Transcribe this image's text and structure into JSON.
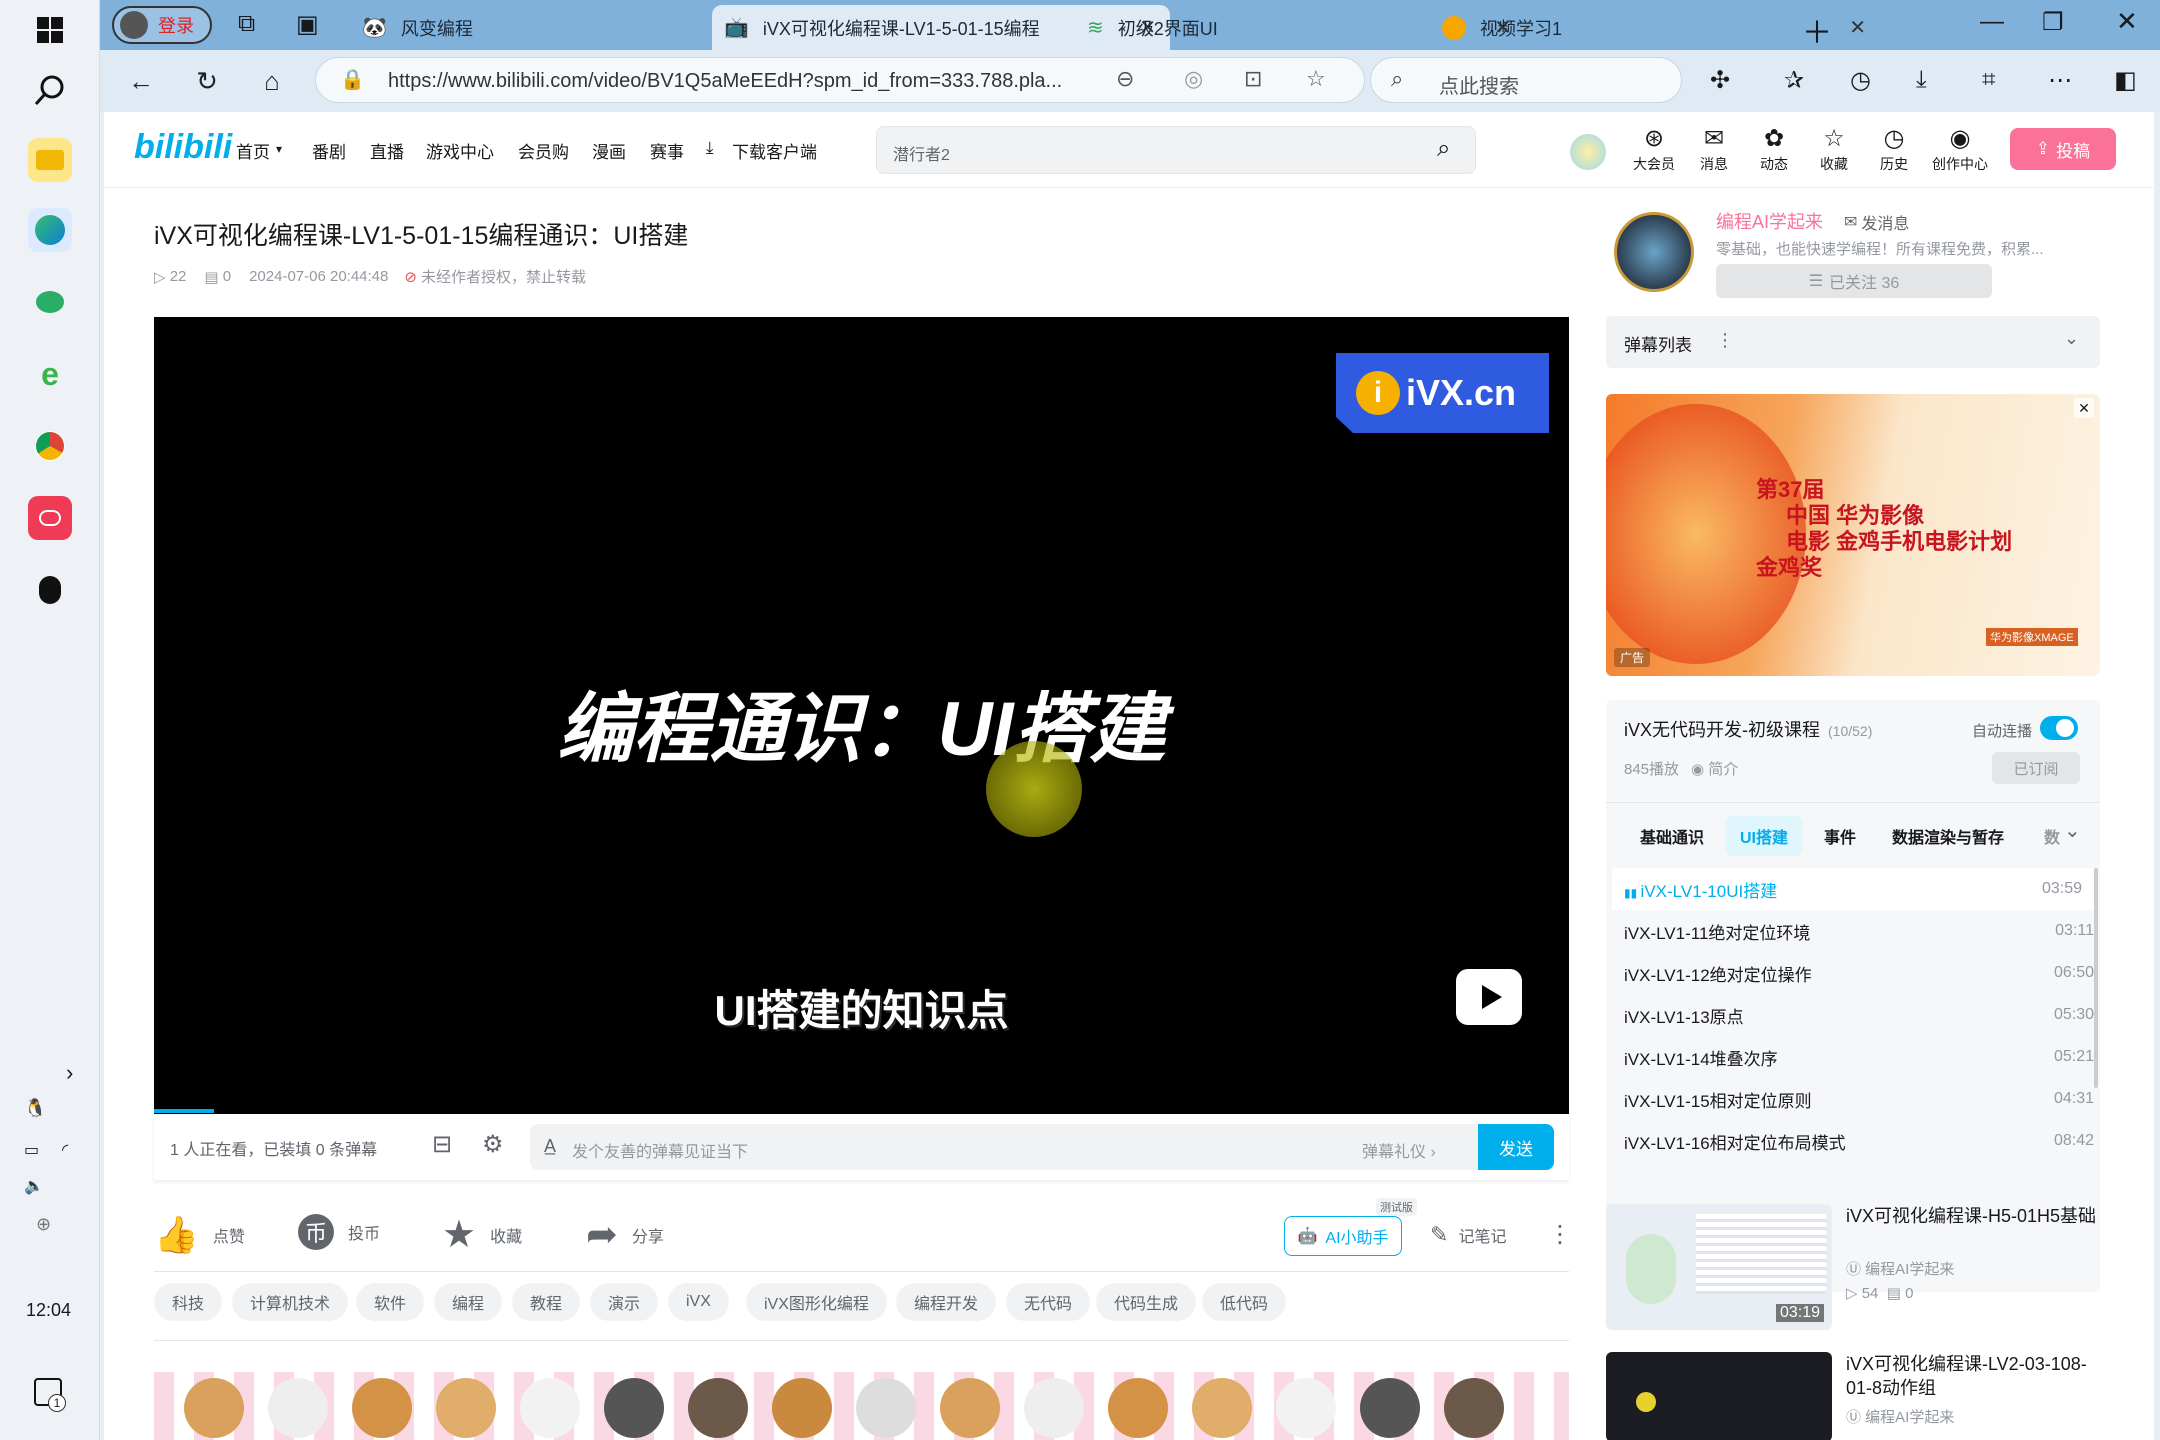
{
  "taskbar": {
    "clock": "12:04",
    "notif_count": "1"
  },
  "browser": {
    "login_label": "登录",
    "tabs": [
      {
        "title": "风变编程"
      },
      {
        "title": "iVX可视化编程课-LV1-5-01-15编程"
      },
      {
        "title": "初级2界面UI"
      },
      {
        "title": "视频学习1"
      }
    ],
    "url": "https://www.bilibili.com/video/BV1Q5aMeEEdH?spm_id_from=333.788.pla...",
    "search_placeholder": "点此搜索"
  },
  "site": {
    "logo": "bilibili",
    "nav": [
      "首页",
      "番剧",
      "直播",
      "游戏中心",
      "会员购",
      "漫画",
      "赛事",
      "下载客户端"
    ],
    "search_value": "潜行者2",
    "right_icons": [
      "大会员",
      "消息",
      "动态",
      "收藏",
      "历史",
      "创作中心"
    ],
    "upload_label": "投稿"
  },
  "video": {
    "title": "iVX可视化编程课-LV1-5-01-15编程通识：UI搭建",
    "views": "22",
    "danmaku": "0",
    "date": "2024-07-06 20:44:48",
    "copyright": "未经作者授权，禁止转载",
    "frame_watermark": "iVX.cn",
    "frame_title": "编程通识：UI搭建",
    "frame_subtitle": "UI搭建的知识点",
    "watching": "1 人正在看，已装填 0 条弹幕",
    "danmaku_placeholder": "发个友善的弹幕见证当下",
    "danmaku_etiquette": "弹幕礼仪 ›",
    "send_label": "发送"
  },
  "actions": {
    "like": "点赞",
    "coin": "投币",
    "fav": "收藏",
    "share": "分享",
    "ai": "AI小助手",
    "ai_badge": "测试版",
    "note": "记笔记"
  },
  "tags": [
    "科技",
    "计算机技术",
    "软件",
    "编程",
    "教程",
    "演示",
    "iVX",
    "iVX图形化编程",
    "编程开发",
    "无代码",
    "代码生成",
    "低代码"
  ],
  "uploader": {
    "name": "编程AI学起来",
    "message": "发消息",
    "desc": "零基础，也能快速学编程！所有课程免费，积累...",
    "follow": "已关注 36"
  },
  "danmaku_list": {
    "title": "弹幕列表"
  },
  "ad": {
    "line1": "第37届",
    "line2": "中国 华为影像",
    "line3": "电影 金鸡手机电影计划",
    "line4": "金鸡奖",
    "brand": "华为影像XMAGE",
    "badge": "广告"
  },
  "collection": {
    "title": "iVX无代码开发-初级课程",
    "count": "(10/52)",
    "autoplay": "自动连播",
    "plays": "845播放",
    "intro": "简介",
    "subscribed": "已订阅",
    "tabs": [
      "基础通识",
      "UI搭建",
      "事件",
      "数据渲染与暂存",
      "数"
    ],
    "episodes": [
      {
        "title": "iVX-LV1-10UI搭建",
        "dur": "03:59"
      },
      {
        "title": "iVX-LV1-11绝对定位环境",
        "dur": "03:11"
      },
      {
        "title": "iVX-LV1-12绝对定位操作",
        "dur": "06:50"
      },
      {
        "title": "iVX-LV1-13原点",
        "dur": "05:30"
      },
      {
        "title": "iVX-LV1-14堆叠次序",
        "dur": "05:21"
      },
      {
        "title": "iVX-LV1-15相对定位原则",
        "dur": "04:31"
      },
      {
        "title": "iVX-LV1-16相对定位布局模式",
        "dur": "08:42"
      }
    ]
  },
  "recommend": [
    {
      "title": "iVX可视化编程课-H5-01H5基础",
      "author": "编程AI学起来",
      "views": "54",
      "comments": "0",
      "dur": "03:19"
    },
    {
      "title": "iVX可视化编程课-LV2-03-108-01-8动作组",
      "author": "编程AI学起来"
    }
  ],
  "colors": {
    "accent": "#00aeec",
    "pink": "#fb7299"
  }
}
